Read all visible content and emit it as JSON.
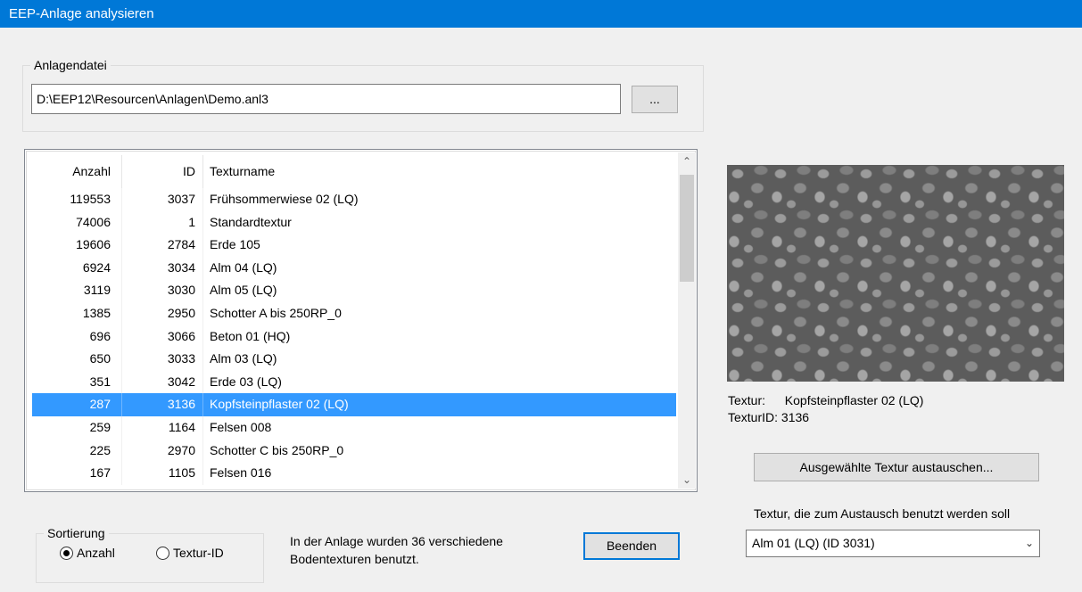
{
  "window": {
    "title": "EEP-Anlage analysieren"
  },
  "file_group": {
    "legend": "Anlagendatei",
    "path": "D:\\EEP12\\Resourcen\\Anlagen\\Demo.anl3",
    "browse_label": "..."
  },
  "table": {
    "columns": {
      "count": "Anzahl",
      "id": "ID",
      "name": "Texturname"
    },
    "rows": [
      {
        "count": "119553",
        "id": "3037",
        "name": "Frühsommerwiese 02 (LQ)"
      },
      {
        "count": "74006",
        "id": "1",
        "name": "Standardtextur"
      },
      {
        "count": "19606",
        "id": "2784",
        "name": "Erde 105"
      },
      {
        "count": "6924",
        "id": "3034",
        "name": "Alm 04 (LQ)"
      },
      {
        "count": "3119",
        "id": "3030",
        "name": "Alm 05 (LQ)"
      },
      {
        "count": "1385",
        "id": "2950",
        "name": "Schotter A bis 250RP_0"
      },
      {
        "count": "696",
        "id": "3066",
        "name": "Beton 01 (HQ)"
      },
      {
        "count": "650",
        "id": "3033",
        "name": "Alm 03 (LQ)"
      },
      {
        "count": "351",
        "id": "3042",
        "name": "Erde 03 (LQ)"
      },
      {
        "count": "287",
        "id": "3136",
        "name": "Kopfsteinpflaster 02 (LQ)"
      },
      {
        "count": "259",
        "id": "1164",
        "name": "Felsen 008"
      },
      {
        "count": "225",
        "id": "2970",
        "name": "Schotter C bis 250RP_0"
      },
      {
        "count": "167",
        "id": "1105",
        "name": "Felsen 016"
      }
    ],
    "selected_index": 9
  },
  "preview": {
    "texture_label": "Textur:",
    "texture_name": "Kopfsteinpflaster 02 (LQ)",
    "texture_id_text": "TexturID: 3136"
  },
  "swap_button_label": "Ausgewählte Textur austauschen...",
  "replacement": {
    "label": "Textur, die zum Austausch benutzt werden soll",
    "selected": "Alm 01 (LQ) (ID 3031)"
  },
  "sort_group": {
    "legend": "Sortierung",
    "options": [
      {
        "label": "Anzahl",
        "checked": true
      },
      {
        "label": "Textur-ID",
        "checked": false
      }
    ]
  },
  "status": {
    "line1": "In der Anlage wurden 36 verschiedene",
    "line2": "Bodentexturen benutzt."
  },
  "close_button_label": "Beenden",
  "colors": {
    "titlebar": "#0078d7",
    "selection": "#3399ff"
  }
}
